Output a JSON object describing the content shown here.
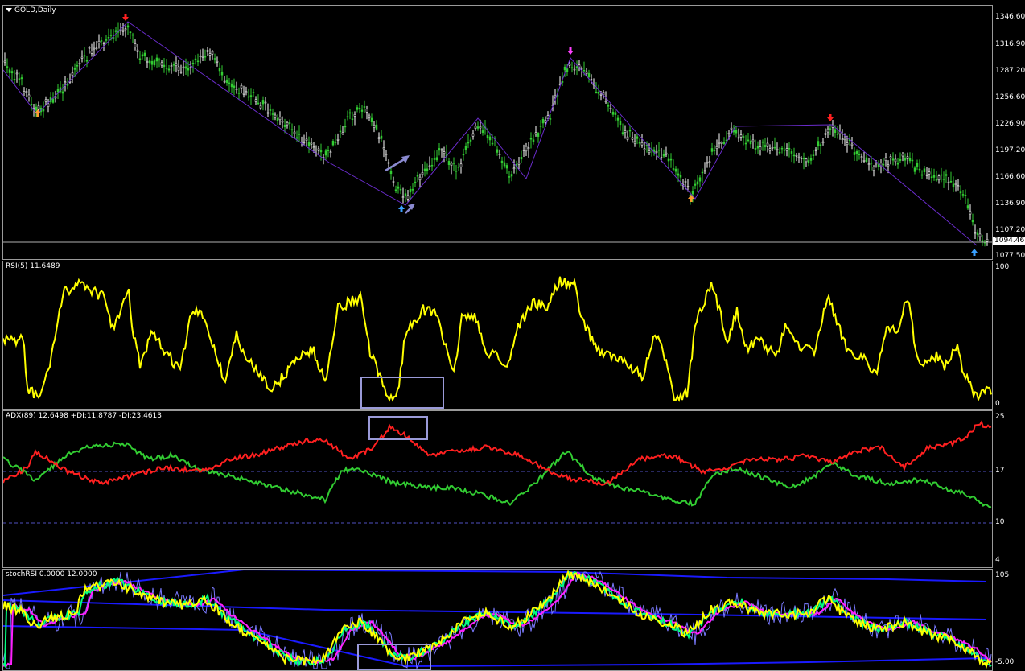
{
  "main": {
    "title": "GOLD,Daily",
    "price_ticks": [
      "1346.60",
      "1316.90",
      "1287.20",
      "1256.60",
      "1226.90",
      "1197.20",
      "1166.60",
      "1136.90",
      "1107.20",
      "1077.50"
    ],
    "last_price": "1094.46",
    "colors": {
      "bull": "#32cd32",
      "bear": "#ffffff",
      "zigzag": "#6a2ccc",
      "hline": "#b0b0b0"
    }
  },
  "rsi": {
    "title": "RSI(5) 11.6489",
    "ticks": [
      "100",
      "0"
    ],
    "color": "#ffff00"
  },
  "adx": {
    "title": "ADX(89) 12.6498 +DI:11.8787 -DI:23.4613",
    "ticks": [
      "25",
      "17",
      "10",
      "4"
    ],
    "colors": {
      "plus_di": "#32cd32",
      "minus_di": "#ff2020",
      "level": "#5050c0"
    }
  },
  "stoch": {
    "title": "stochRSI 0.0000 12.0000",
    "ticks": [
      "105",
      "-5.00"
    ],
    "colors": {
      "main": "#ffff00",
      "signal": "#00ff7f",
      "slow": "#ff20ff",
      "band": "#1a1aff",
      "env": "#7a7aff"
    }
  },
  "markers": {
    "arrow_down_red": "#ff2020",
    "arrow_down_magenta": "#ff40ff",
    "arrow_up_orange": "#ff9a2e",
    "arrow_up_blue": "#3aa0ff"
  }
}
